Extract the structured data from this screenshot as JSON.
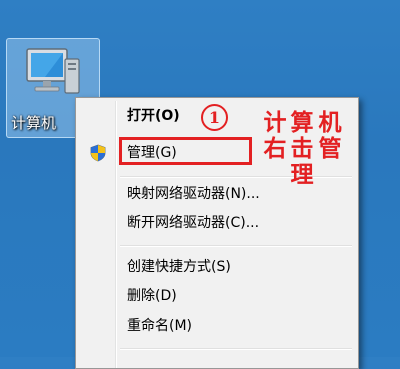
{
  "desktop": {
    "icon": {
      "name": "computer-icon",
      "label": "计算机"
    }
  },
  "context_menu": {
    "items": [
      {
        "label": "打开(O)",
        "bold": true
      },
      {
        "label": "管理(G)",
        "icon": "shield-icon"
      },
      {
        "label": "映射网络驱动器(N)..."
      },
      {
        "label": "断开网络驱动器(C)..."
      },
      {
        "label": "创建快捷方式(S)"
      },
      {
        "label": "删除(D)"
      },
      {
        "label": "重命名(M)"
      }
    ]
  },
  "annotation": {
    "step": "1",
    "note_col1": "计右",
    "note_col2": "算击理",
    "note_col3": "机管",
    "color": "#e32022"
  }
}
